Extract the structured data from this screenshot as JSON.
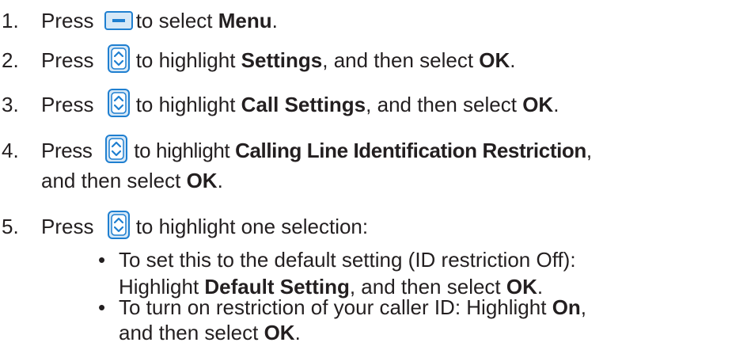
{
  "steps": [
    {
      "number": "1.",
      "pre": "Press ",
      "icon": "soft-key-icon",
      "post": "to select ",
      "bold1": "Menu",
      "tail1": "."
    },
    {
      "number": "2.",
      "pre": "Press ",
      "icon": "navigation-key-icon",
      "post": "to highlight ",
      "bold1": "Settings",
      "mid": ", and then select ",
      "bold2": "OK",
      "tail": "."
    },
    {
      "number": "3.",
      "pre": "Press ",
      "icon": "navigation-key-icon",
      "post": "to highlight ",
      "bold1": "Call Settings",
      "mid": ", and then select ",
      "bold2": "OK",
      "tail": "."
    },
    {
      "number": "4.",
      "pre": "Press ",
      "icon": "navigation-key-icon",
      "post": "to highlight ",
      "bold1": "Calling Line Identification Restriction",
      "tail1": ",",
      "cont_pre": "and then select ",
      "cont_bold": "OK",
      "cont_tail": "."
    },
    {
      "number": "5.",
      "pre": "Press ",
      "icon": "navigation-key-icon",
      "post": "to highlight one selection:"
    }
  ],
  "bullets": [
    {
      "symbol": "•",
      "line1": "To set this to the default setting (ID restriction Off):",
      "line2_pre": "Highlight ",
      "line2_bold": "Default Setting",
      "line2_mid": ", and then select ",
      "line2_bold2": "OK",
      "line2_tail": "."
    },
    {
      "symbol": "•",
      "line1_pre": "To turn on restriction of your caller ID: Highlight ",
      "line1_bold": "On",
      "line1_tail": ",",
      "line2_pre": "and then select ",
      "line2_bold": "OK",
      "line2_tail": "."
    }
  ],
  "colors": {
    "text": "#231f20",
    "icon_blue": "#1f7fd0",
    "icon_light": "#d6e8f7"
  }
}
